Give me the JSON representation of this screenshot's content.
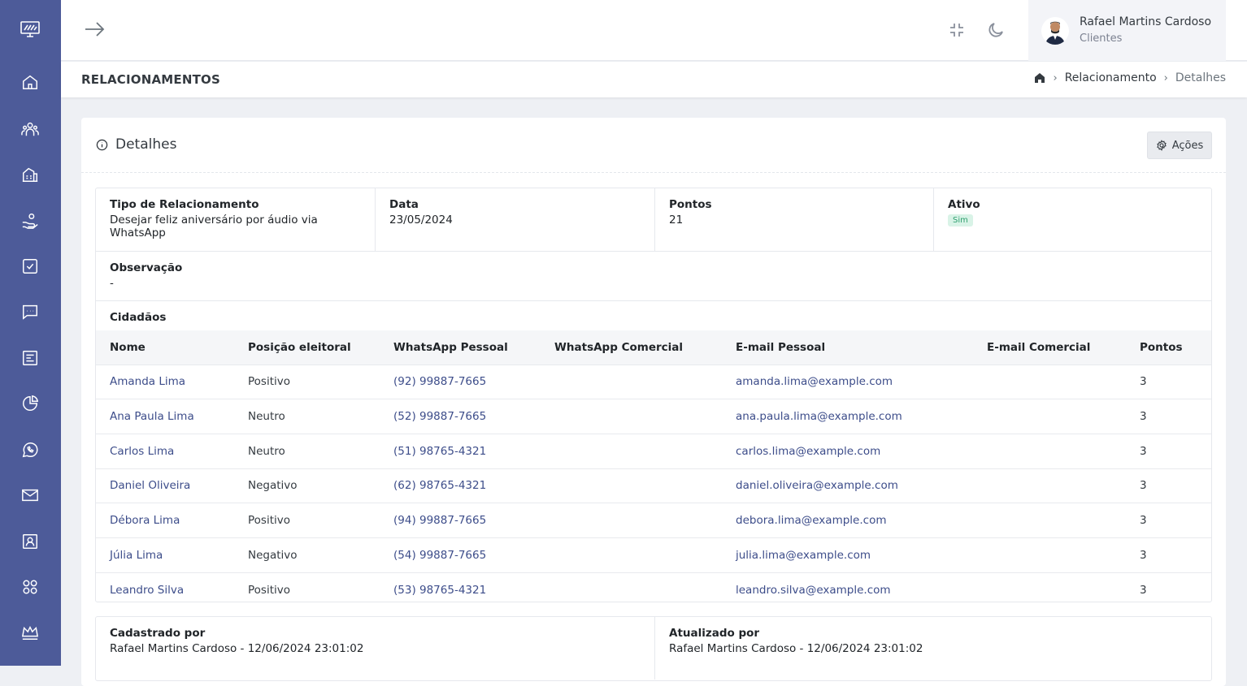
{
  "header": {
    "user_name": "Rafael Martins Cardoso",
    "user_role": "Clientes"
  },
  "subheader": {
    "title": "RELACIONAMENTOS",
    "breadcrumb": [
      "Relacionamento",
      "Detalhes"
    ]
  },
  "card": {
    "title": "Detalhes",
    "actions_label": "Ações",
    "fields": {
      "tipo_label": "Tipo de Relacionamento",
      "tipo_value": "Desejar feliz aniversário por áudio via WhatsApp",
      "data_label": "Data",
      "data_value": "23/05/2024",
      "pontos_label": "Pontos",
      "pontos_value": "21",
      "ativo_label": "Ativo",
      "ativo_value": "Sim",
      "obs_label": "Observação",
      "obs_value": "-"
    },
    "cidadaos_label": "Cidadãos",
    "columns": [
      "Nome",
      "Posição eleitoral",
      "WhatsApp Pessoal",
      "WhatsApp Comercial",
      "E-mail Pessoal",
      "E-mail Comercial",
      "Pontos"
    ],
    "rows": [
      {
        "nome": "Amanda Lima",
        "posicao": "Positivo",
        "wpp": "(92) 99887-7665",
        "wpp_com": "",
        "email": "amanda.lima@example.com",
        "email_com": "",
        "pontos": "3"
      },
      {
        "nome": "Ana Paula Lima",
        "posicao": "Neutro",
        "wpp": "(52) 99887-7665",
        "wpp_com": "",
        "email": "ana.paula.lima@example.com",
        "email_com": "",
        "pontos": "3"
      },
      {
        "nome": "Carlos Lima",
        "posicao": "Neutro",
        "wpp": "(51) 98765-4321",
        "wpp_com": "",
        "email": "carlos.lima@example.com",
        "email_com": "",
        "pontos": "3"
      },
      {
        "nome": "Daniel Oliveira",
        "posicao": "Negativo",
        "wpp": "(62) 98765-4321",
        "wpp_com": "",
        "email": "daniel.oliveira@example.com",
        "email_com": "",
        "pontos": "3"
      },
      {
        "nome": "Débora Lima",
        "posicao": "Positivo",
        "wpp": "(94) 99887-7665",
        "wpp_com": "",
        "email": "debora.lima@example.com",
        "email_com": "",
        "pontos": "3"
      },
      {
        "nome": "Júlia Lima",
        "posicao": "Negativo",
        "wpp": "(54) 99887-7665",
        "wpp_com": "",
        "email": "julia.lima@example.com",
        "email_com": "",
        "pontos": "3"
      },
      {
        "nome": "Leandro Silva",
        "posicao": "Positivo",
        "wpp": "(53) 98765-4321",
        "wpp_com": "",
        "email": "leandro.silva@example.com",
        "email_com": "",
        "pontos": "3"
      }
    ],
    "footer": {
      "cadastrado_label": "Cadastrado por",
      "cadastrado_value": "Rafael Martins Cardoso - 12/06/2024 23:01:02",
      "atualizado_label": "Atualizado por",
      "atualizado_value": "Rafael Martins Cardoso - 12/06/2024 23:01:02"
    }
  },
  "sidebar_icons": [
    "logo-icon",
    "home-icon",
    "people-icon",
    "building-icon",
    "hand-coin-icon",
    "checkbox-icon",
    "chat-icon",
    "document-icon",
    "pie-chart-icon",
    "whatsapp-icon",
    "mail-icon",
    "contact-card-icon",
    "apps-icon",
    "crown-icon"
  ],
  "colors": {
    "sidebar": "#4d5b99",
    "link": "#3d4d8a",
    "badge_bg": "#d9f3e7",
    "badge_text": "#2f9f6f"
  }
}
